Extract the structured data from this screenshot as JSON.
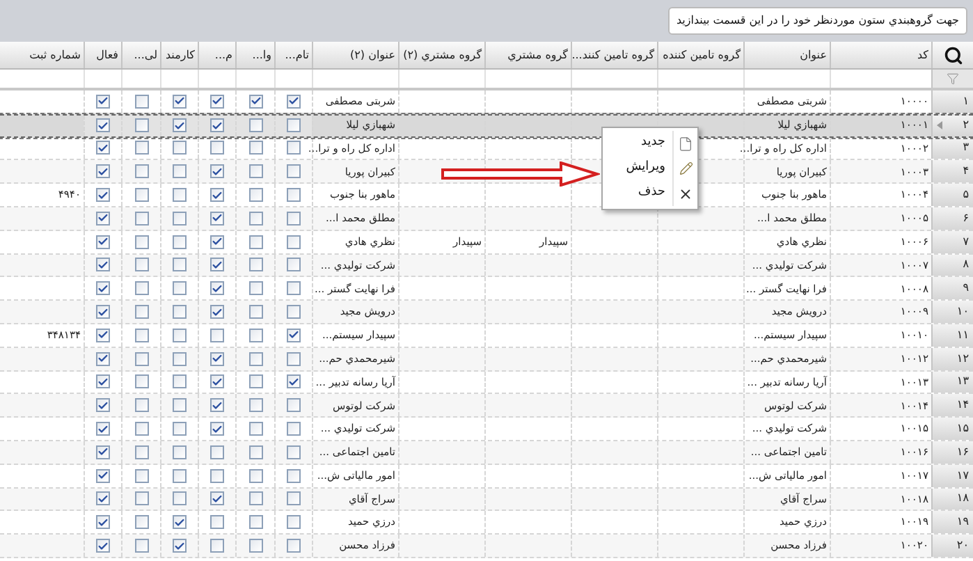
{
  "group_panel": {
    "hint": "جهت گروهبندي ستون موردنظر خود را در این قسمت بیندازید"
  },
  "columns": [
    {
      "label": "کد"
    },
    {
      "label": "عنوان"
    },
    {
      "label": "گروه تامین کننده"
    },
    {
      "label": "گروه تامین کنند..."
    },
    {
      "label": "گروه مشتري"
    },
    {
      "label": "گروه مشتري (۲)"
    },
    {
      "label": "عنوان (۲)"
    },
    {
      "label": "تام..."
    },
    {
      "label": "وا..."
    },
    {
      "label": "م..."
    },
    {
      "label": "کارمند"
    },
    {
      "label": "لی..."
    },
    {
      "label": "فعال"
    },
    {
      "label": "شماره ثبت"
    }
  ],
  "rows": [
    {
      "number": "۱",
      "selected": false,
      "code": "۱۰۰۰۰",
      "title": "شربتی مصطفی",
      "title_2": "شربتی مصطفی",
      "flags": [
        true,
        true,
        true,
        true,
        false,
        true
      ]
    },
    {
      "number": "۲",
      "selected": true,
      "code": "۱۰۰۰۱",
      "title": "شهبازي لیلا",
      "title_2": "شهبازي لیلا",
      "flags": [
        false,
        false,
        true,
        true,
        false,
        true
      ]
    },
    {
      "number": "۳",
      "selected": false,
      "code": "۱۰۰۰۲",
      "title": "اداره کل راه و ترا...",
      "title_2": "اداره کل راه و ترا...",
      "flags": [
        false,
        false,
        false,
        false,
        false,
        true
      ]
    },
    {
      "number": "۴",
      "selected": false,
      "code": "۱۰۰۰۳",
      "title": "کبیران پوریا",
      "title_2": "کبیران پوریا",
      "flags": [
        false,
        false,
        true,
        false,
        false,
        true
      ]
    },
    {
      "number": "۵",
      "selected": false,
      "code": "۱۰۰۰۴",
      "title": "ماهور بنا جنوب",
      "title_2": "ماهور بنا جنوب",
      "flags": [
        false,
        false,
        true,
        false,
        false,
        true
      ],
      "registration_number": "۴۹۴۰"
    },
    {
      "number": "۶",
      "selected": false,
      "code": "۱۰۰۰۵",
      "title": "مطلق محمد ا...",
      "title_2": "مطلق محمد ا...",
      "flags": [
        false,
        false,
        true,
        false,
        false,
        true
      ]
    },
    {
      "number": "۷",
      "selected": false,
      "code": "۱۰۰۰۶",
      "title": "نظري هادي",
      "title_2": "نظري هادي",
      "customer_group": "سپیدار",
      "customer_group_2": "سپیدار",
      "flags": [
        false,
        false,
        true,
        false,
        false,
        true
      ]
    },
    {
      "number": "۸",
      "selected": false,
      "code": "۱۰۰۰۷",
      "title": "شرکت تولیدي ...",
      "title_2": "شرکت تولیدي ...",
      "flags": [
        false,
        false,
        true,
        false,
        false,
        true
      ]
    },
    {
      "number": "۹",
      "selected": false,
      "code": "۱۰۰۰۸",
      "title": "فرا نهایت گستر ...",
      "title_2": "فرا نهایت گستر ...",
      "flags": [
        false,
        false,
        true,
        false,
        false,
        true
      ]
    },
    {
      "number": "۱۰",
      "selected": false,
      "code": "۱۰۰۰۹",
      "title": "درویش مجید",
      "title_2": "درویش مجید",
      "flags": [
        false,
        false,
        true,
        false,
        false,
        true
      ]
    },
    {
      "number": "۱۱",
      "selected": false,
      "code": "۱۰۰۱۰",
      "title": "سپیدار سیستم...",
      "title_2": "سپیدار سیستم...",
      "flags": [
        true,
        false,
        false,
        false,
        false,
        true
      ],
      "registration_number": "۳۴۸۱۳۴"
    },
    {
      "number": "۱۲",
      "selected": false,
      "code": "۱۰۰۱۲",
      "title": "شیرمحمدي حم...",
      "title_2": "شیرمحمدي حم...",
      "flags": [
        false,
        false,
        true,
        false,
        false,
        true
      ]
    },
    {
      "number": "۱۳",
      "selected": false,
      "code": "۱۰۰۱۳",
      "title": "آریا رسانه تدبیر ...",
      "title_2": "آریا رسانه تدبیر ...",
      "flags": [
        true,
        false,
        true,
        false,
        false,
        true
      ]
    },
    {
      "number": "۱۴",
      "selected": false,
      "code": "۱۰۰۱۴",
      "title": "شرکت لوتوس",
      "title_2": "شرکت لوتوس",
      "flags": [
        false,
        false,
        true,
        false,
        false,
        true
      ]
    },
    {
      "number": "۱۵",
      "selected": false,
      "code": "۱۰۰۱۵",
      "title": "شرکت تولیدي ...",
      "title_2": "شرکت تولیدي ...",
      "flags": [
        false,
        false,
        true,
        false,
        false,
        true
      ]
    },
    {
      "number": "۱۶",
      "selected": false,
      "code": "۱۰۰۱۶",
      "title": "تامین اجتماعی ...",
      "title_2": "تامین اجتماعی ...",
      "flags": [
        false,
        false,
        false,
        false,
        false,
        true
      ]
    },
    {
      "number": "۱۷",
      "selected": false,
      "code": "۱۰۰۱۷",
      "title": "امور مالیاتی ش...",
      "title_2": "امور مالیاتی ش...",
      "flags": [
        false,
        false,
        false,
        false,
        false,
        true
      ]
    },
    {
      "number": "۱۸",
      "selected": false,
      "code": "۱۰۰۱۸",
      "title": "سراج آقاي",
      "title_2": "سراج آقاي",
      "flags": [
        false,
        false,
        true,
        false,
        false,
        true
      ]
    },
    {
      "number": "۱۹",
      "selected": false,
      "code": "۱۰۰۱۹",
      "title": "درزي حمید",
      "title_2": "درزي حمید",
      "flags": [
        false,
        false,
        false,
        true,
        false,
        true
      ]
    },
    {
      "number": "۲۰",
      "selected": false,
      "code": "۱۰۰۲۰",
      "title": "فرزاد محسن",
      "title_2": "فرزاد محسن",
      "flags": [
        false,
        false,
        false,
        true,
        false,
        true
      ]
    }
  ],
  "context_menu": [
    {
      "label": "جدید",
      "kind": "new"
    },
    {
      "label": "ویرایش",
      "kind": "edit"
    },
    {
      "label": "حذف",
      "kind": "delete"
    }
  ]
}
